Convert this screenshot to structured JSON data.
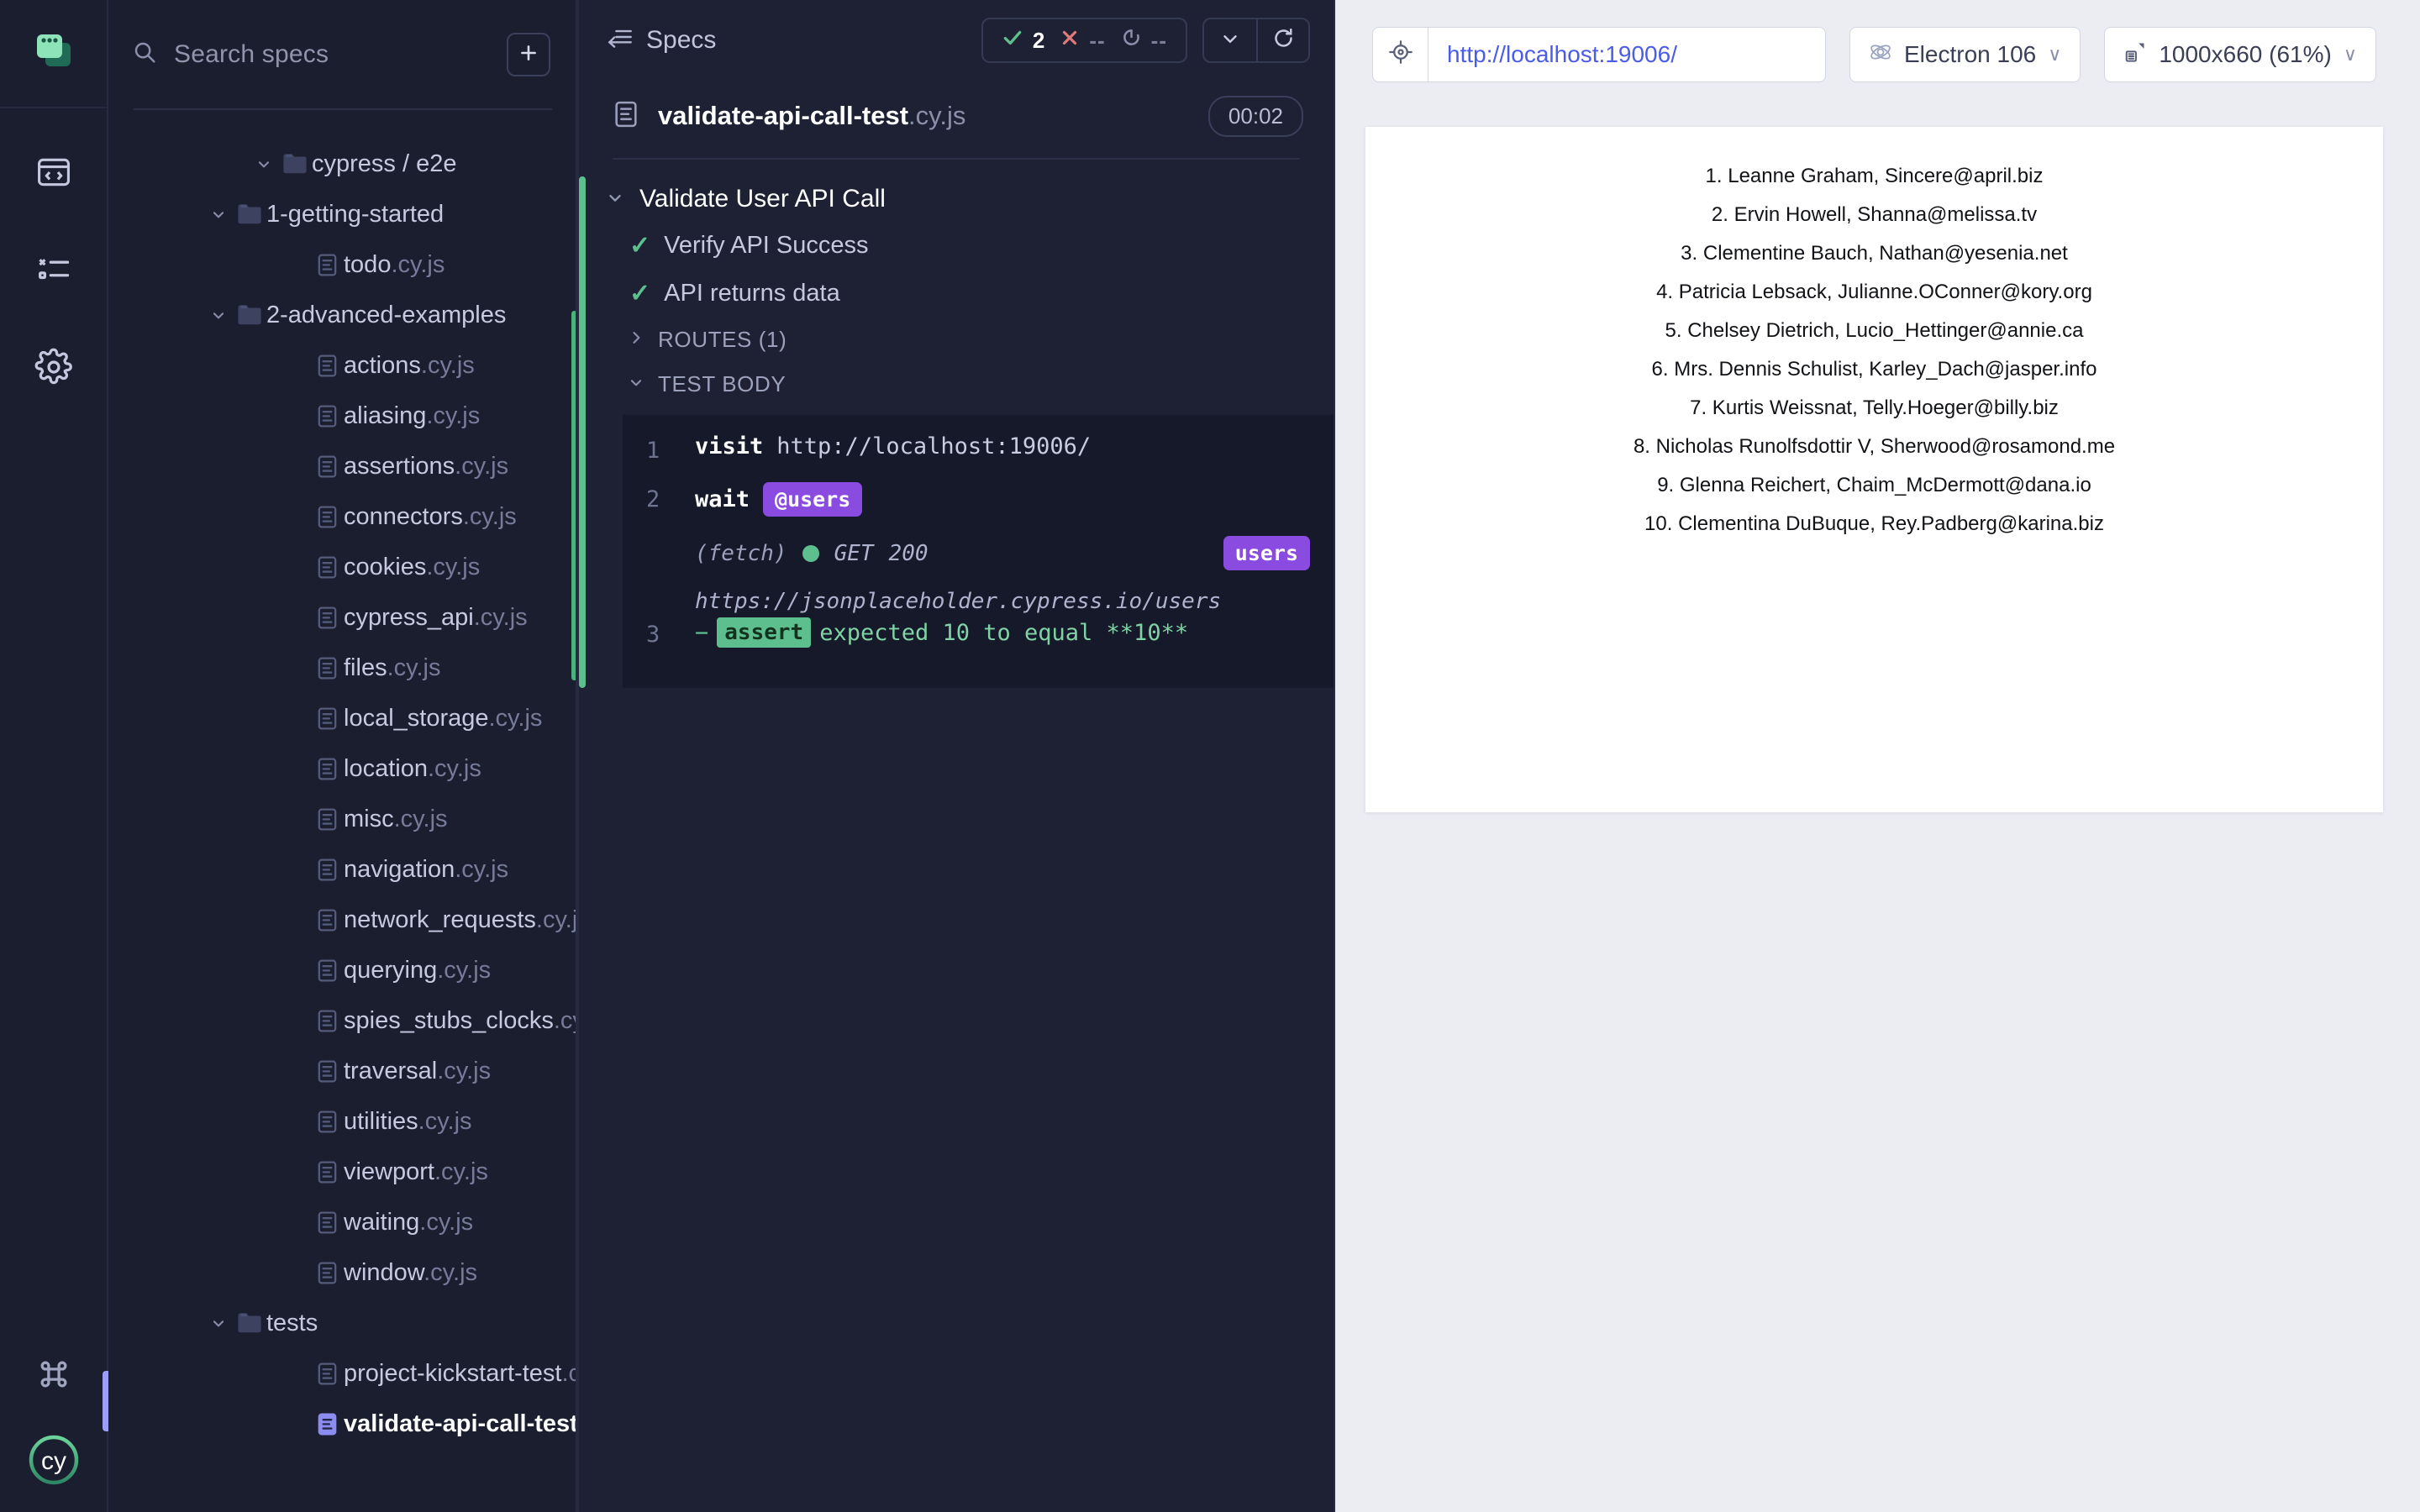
{
  "rail": {
    "logo_icon": "cypress-window-icon",
    "items": [
      {
        "name": "specs",
        "icon": "code-window-icon"
      },
      {
        "name": "runs",
        "icon": "checklist-icon"
      },
      {
        "name": "settings",
        "icon": "gear-icon"
      }
    ],
    "bottom": [
      {
        "name": "keyboard-shortcuts",
        "icon": "command-key-icon"
      },
      {
        "name": "cypress-logo",
        "icon": "cy-circle-logo",
        "label": "cy"
      }
    ]
  },
  "sidebar": {
    "search": {
      "placeholder": "Search specs",
      "value": "",
      "icon": "search-icon"
    },
    "add_button": {
      "label": "+",
      "icon": "plus-icon"
    },
    "tree": [
      {
        "depth": 0,
        "type": "folder",
        "name": "cypress / e2e",
        "expanded": true
      },
      {
        "depth": 1,
        "type": "folder",
        "name": "1-getting-started",
        "expanded": true
      },
      {
        "depth": 2,
        "type": "spec",
        "name": "todo",
        "ext": ".cy.js"
      },
      {
        "depth": 1,
        "type": "folder",
        "name": "2-advanced-examples",
        "expanded": true
      },
      {
        "depth": 2,
        "type": "spec",
        "name": "actions",
        "ext": ".cy.js"
      },
      {
        "depth": 2,
        "type": "spec",
        "name": "aliasing",
        "ext": ".cy.js"
      },
      {
        "depth": 2,
        "type": "spec",
        "name": "assertions",
        "ext": ".cy.js"
      },
      {
        "depth": 2,
        "type": "spec",
        "name": "connectors",
        "ext": ".cy.js"
      },
      {
        "depth": 2,
        "type": "spec",
        "name": "cookies",
        "ext": ".cy.js"
      },
      {
        "depth": 2,
        "type": "spec",
        "name": "cypress_api",
        "ext": ".cy.js"
      },
      {
        "depth": 2,
        "type": "spec",
        "name": "files",
        "ext": ".cy.js"
      },
      {
        "depth": 2,
        "type": "spec",
        "name": "local_storage",
        "ext": ".cy.js"
      },
      {
        "depth": 2,
        "type": "spec",
        "name": "location",
        "ext": ".cy.js"
      },
      {
        "depth": 2,
        "type": "spec",
        "name": "misc",
        "ext": ".cy.js"
      },
      {
        "depth": 2,
        "type": "spec",
        "name": "navigation",
        "ext": ".cy.js"
      },
      {
        "depth": 2,
        "type": "spec",
        "name": "network_requests",
        "ext": ".cy.js"
      },
      {
        "depth": 2,
        "type": "spec",
        "name": "querying",
        "ext": ".cy.js"
      },
      {
        "depth": 2,
        "type": "spec",
        "name": "spies_stubs_clocks",
        "ext": ".cy.js"
      },
      {
        "depth": 2,
        "type": "spec",
        "name": "traversal",
        "ext": ".cy.js"
      },
      {
        "depth": 2,
        "type": "spec",
        "name": "utilities",
        "ext": ".cy.js"
      },
      {
        "depth": 2,
        "type": "spec",
        "name": "viewport",
        "ext": ".cy.js"
      },
      {
        "depth": 2,
        "type": "spec",
        "name": "waiting",
        "ext": ".cy.js"
      },
      {
        "depth": 2,
        "type": "spec",
        "name": "window",
        "ext": ".cy.js"
      },
      {
        "depth": 1,
        "type": "folder",
        "name": "tests",
        "expanded": true
      },
      {
        "depth": 2,
        "type": "spec",
        "name": "project-kickstart-test",
        "ext": ".cy.js"
      },
      {
        "depth": 2,
        "type": "spec",
        "name": "validate-api-call-test",
        "ext": ".cy.js",
        "selected": true
      }
    ]
  },
  "reporter": {
    "back_label": "Specs",
    "back_icon": "arrow-left-lines-icon",
    "stats": {
      "passed": {
        "icon": "check-icon",
        "value": "2",
        "color": "#5DBF8E"
      },
      "failed": {
        "icon": "x-icon",
        "value": "--",
        "color": "#E07A7A"
      },
      "pending": {
        "icon": "circle-dash-icon",
        "value": "--",
        "color": "#8A90AC"
      }
    },
    "controls": [
      {
        "name": "collapse-all",
        "icon": "chevron-down-icon"
      },
      {
        "name": "restart-tests",
        "icon": "reload-icon"
      }
    ],
    "spec": {
      "icon": "spec-file-icon",
      "name": "validate-api-call-test",
      "ext": ".cy.js",
      "duration": "00:02"
    },
    "suite": {
      "title": "Validate User API Call",
      "expanded": true,
      "tests": [
        {
          "title": "Verify API Success",
          "state": "passed"
        },
        {
          "title": "API returns data",
          "state": "passed"
        }
      ],
      "sections": [
        {
          "label": "ROUTES (1)",
          "expanded": false
        },
        {
          "label": "TEST BODY",
          "expanded": true
        }
      ]
    },
    "commands": [
      {
        "num": "1",
        "keyword": "visit",
        "arg": "http://localhost:19006/"
      },
      {
        "num": "2",
        "keyword": "wait",
        "alias": "@users"
      }
    ],
    "xhr": {
      "type": "(fetch)",
      "method": "GET",
      "status": "200",
      "url": "https://jsonplaceholder.cypress.io/users",
      "alias": "users",
      "status_color": "#5DBF8E"
    },
    "assertion": {
      "num": "3",
      "label": "assert",
      "text": "expected 10 to equal **10**"
    }
  },
  "preview": {
    "url": "http://localhost:19006/",
    "selector_icon": "selector-playground-icon",
    "browser": {
      "label": "Electron 106",
      "icon": "electron-icon",
      "caret": "∨"
    },
    "viewport": {
      "label": "1000x660 (61%)",
      "icon": "ruler-icon",
      "caret": "∨"
    },
    "users": [
      "1. Leanne Graham, Sincere@april.biz",
      "2. Ervin Howell, Shanna@melissa.tv",
      "3. Clementine Bauch, Nathan@yesenia.net",
      "4. Patricia Lebsack, Julianne.OConner@kory.org",
      "5. Chelsey Dietrich, Lucio_Hettinger@annie.ca",
      "6. Mrs. Dennis Schulist, Karley_Dach@jasper.info",
      "7. Kurtis Weissnat, Telly.Hoeger@billy.biz",
      "8. Nicholas Runolfsdottir V, Sherwood@rosamond.me",
      "9. Glenna Reichert, Chaim_McDermott@dana.io",
      "10. Clementina DuBuque, Rey.Padberg@karina.biz"
    ]
  }
}
